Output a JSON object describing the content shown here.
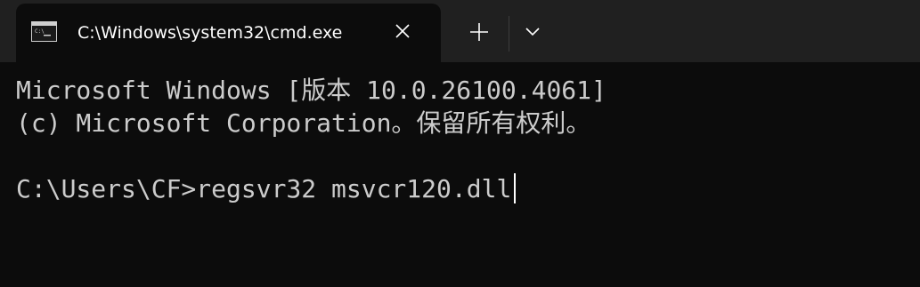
{
  "tab": {
    "title": "C:\\Windows\\system32\\cmd.exe",
    "icon": "cmd-icon"
  },
  "titlebar": {
    "close_icon": "close-icon",
    "new_tab_icon": "plus-icon",
    "dropdown_icon": "chevron-down-icon"
  },
  "console": {
    "lines": [
      "Microsoft Windows [版本 10.0.26100.4061]",
      "(c) Microsoft Corporation。保留所有权利。",
      "",
      "C:\\Users\\CF>regsvr32 msvcr120.dll"
    ]
  },
  "colors": {
    "background": "#0c0c0c",
    "titlebar": "#202020",
    "text": "#cccccc"
  }
}
